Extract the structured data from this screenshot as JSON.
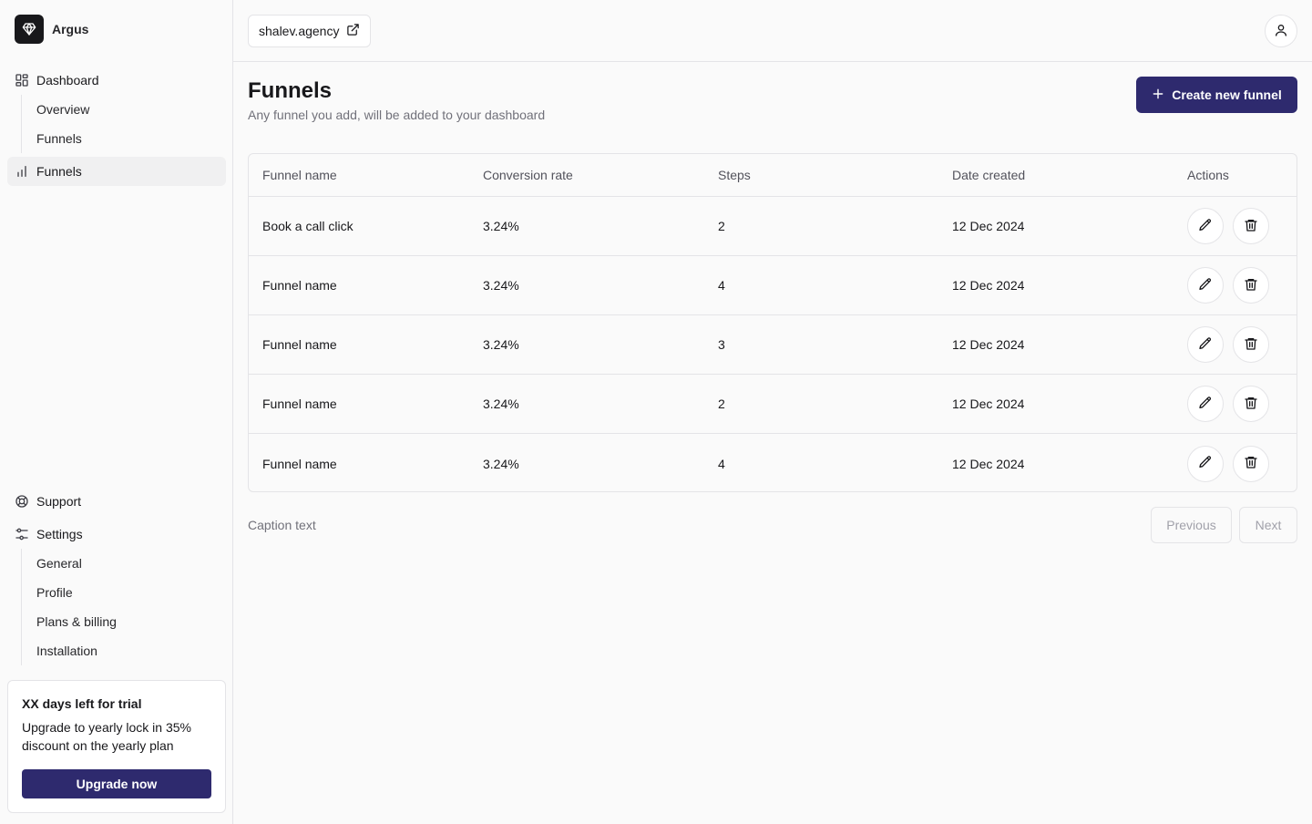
{
  "app": {
    "name": "Argus"
  },
  "sidebar": {
    "dashboard": {
      "label": "Dashboard",
      "children": [
        "Overview",
        "Funnels"
      ]
    },
    "funnels": {
      "label": "Funnels"
    },
    "support": {
      "label": "Support"
    },
    "settings": {
      "label": "Settings",
      "children": [
        "General",
        "Profile",
        "Plans & billing",
        "Installation"
      ]
    },
    "trial": {
      "title": "XX days left for trial",
      "text": "Upgrade to yearly lock in 35% discount on the yearly plan",
      "button": "Upgrade now"
    }
  },
  "topbar": {
    "site": "shalev.agency"
  },
  "page": {
    "title": "Funnels",
    "subtitle": "Any funnel you add, will be added to your dashboard",
    "create_button": "Create new funnel"
  },
  "table": {
    "headers": [
      "Funnel name",
      "Conversion rate",
      "Steps",
      "Date created",
      "Actions"
    ],
    "rows": [
      {
        "name": "Book a call click",
        "rate": "3.24%",
        "steps": "2",
        "date": "12 Dec 2024"
      },
      {
        "name": "Funnel name",
        "rate": "3.24%",
        "steps": "4",
        "date": "12 Dec 2024"
      },
      {
        "name": "Funnel name",
        "rate": "3.24%",
        "steps": "3",
        "date": "12 Dec 2024"
      },
      {
        "name": "Funnel name",
        "rate": "3.24%",
        "steps": "2",
        "date": "12 Dec 2024"
      },
      {
        "name": "Funnel name",
        "rate": "3.24%",
        "steps": "4",
        "date": "12 Dec 2024"
      }
    ],
    "caption": "Caption text"
  },
  "pagination": {
    "previous": "Previous",
    "next": "Next"
  },
  "colors": {
    "accent": "#2e2a6e",
    "border": "#e4e4e7",
    "muted": "#71717a"
  }
}
